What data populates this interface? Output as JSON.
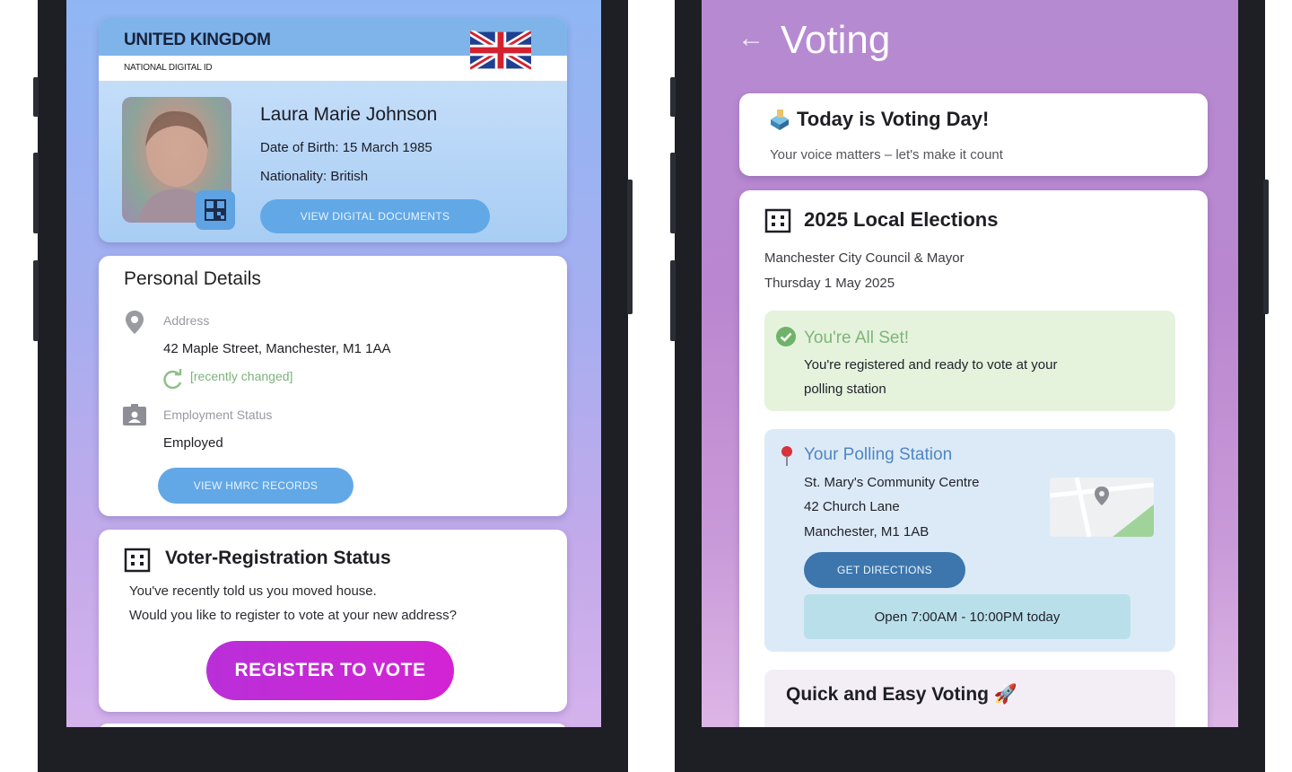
{
  "left_screen": {
    "id_card": {
      "country": "UNITED KINGDOM",
      "sublabel": "NATIONAL DIGITAL ID",
      "name": "Laura Marie Johnson",
      "dob": "Date of Birth: 15 March 1985",
      "nationality": "Nationality: British",
      "view_docs_label": "VIEW DIGITAL DOCUMENTS"
    },
    "personal_details": {
      "title": "Personal Details",
      "address_label": "Address",
      "address_value": "42 Maple Street, Manchester, M1 1AA",
      "changed_note": "[recently changed]",
      "employment_label": "Employment Status",
      "employment_value": "Employed",
      "hmrc_label": "VIEW HMRC RECORDS"
    },
    "voter_registration": {
      "title": "Voter-Registration Status",
      "message_line1": "You've recently told us you moved house.",
      "message_line2": "Would you like to register to vote at your new address?",
      "register_label": "REGISTER TO VOTE"
    }
  },
  "right_screen": {
    "header": {
      "back_icon": "←",
      "title": "Voting"
    },
    "today": {
      "title": "Today is Voting Day!",
      "subtitle": "Your voice matters – let's make it count"
    },
    "election": {
      "title": "2025 Local Elections",
      "council": "Manchester City Council & Mayor",
      "date": "Thursday 1 May 2025",
      "all_set": {
        "title": "You're All Set!",
        "line1": "You're registered and ready to vote at your",
        "line2": "polling station"
      },
      "polling_station": {
        "title": "Your Polling Station",
        "name": "St. Mary's Community Centre",
        "street": "42 Church Lane",
        "city": "Manchester, M1 1AB",
        "directions_label": "GET DIRECTIONS",
        "hours": "Open 7:00AM - 10:00PM today"
      },
      "quick_voting": {
        "title": "Quick and Easy Voting 🚀"
      }
    }
  },
  "colors": {
    "left_bg_top": "#8fb6f3",
    "right_bg_top": "#b68ad1",
    "primary_button": "#62a8e6",
    "register_button": "#c42ad6",
    "directions_button": "#3d76ad",
    "success_text": "#7fb47a"
  }
}
